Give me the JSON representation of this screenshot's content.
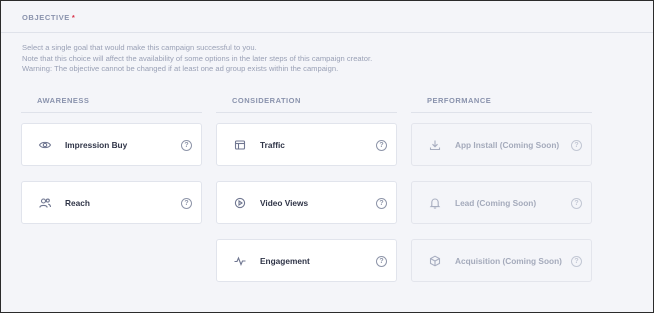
{
  "objective": {
    "title": "OBJECTIVE",
    "required_mark": "*",
    "description": [
      "Select a single goal that would make this campaign successful to you.",
      "Note that this choice will affect the availability of some options in the later steps of this campaign creator.",
      "Warning: The objective cannot be changed if at least one ad group exists within the campaign."
    ]
  },
  "columns": {
    "awareness": {
      "heading": "AWARENESS",
      "items": [
        {
          "label": "Impression Buy",
          "icon": "eye-icon",
          "help": "?"
        },
        {
          "label": "Reach",
          "icon": "users-icon",
          "help": "?"
        }
      ]
    },
    "consideration": {
      "heading": "CONSIDERATION",
      "items": [
        {
          "label": "Traffic",
          "icon": "browser-window-icon",
          "help": "?"
        },
        {
          "label": "Video Views",
          "icon": "play-circle-icon",
          "help": "?"
        },
        {
          "label": "Engagement",
          "icon": "activity-icon",
          "help": "?"
        }
      ]
    },
    "performance": {
      "heading": "PERFORMANCE",
      "items": [
        {
          "label": "App Install (Coming Soon)",
          "icon": "download-icon",
          "help": "?"
        },
        {
          "label": "Lead (Coming Soon)",
          "icon": "bell-icon",
          "help": "?"
        },
        {
          "label": "Acquisition (Coming Soon)",
          "icon": "package-icon",
          "help": "?"
        }
      ]
    }
  },
  "colors": {
    "background": "#f4f5f9",
    "card": "#ffffff",
    "required": "#d9334a",
    "heading": "#8a93ad"
  }
}
